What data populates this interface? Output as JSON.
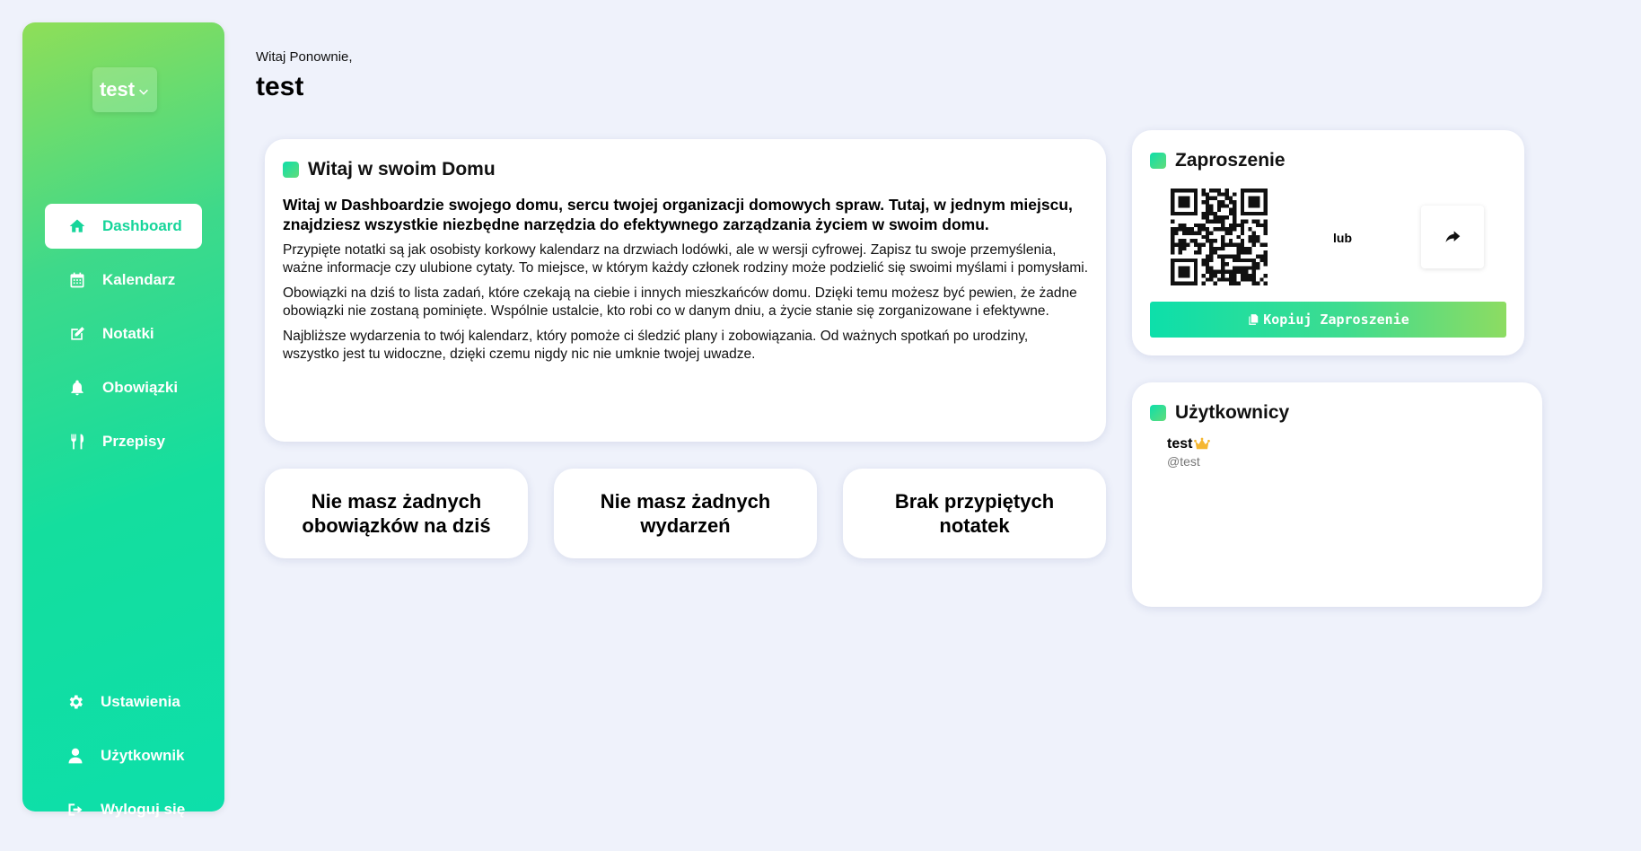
{
  "sidebar": {
    "house_name": "test",
    "nav": [
      {
        "label": "Dashboard",
        "icon": "home-icon",
        "active": true
      },
      {
        "label": "Kalendarz",
        "icon": "calendar-icon"
      },
      {
        "label": "Notatki",
        "icon": "edit-icon"
      },
      {
        "label": "Obowiązki",
        "icon": "bell-icon"
      },
      {
        "label": "Przepisy",
        "icon": "utensils-icon"
      }
    ],
    "bottom_nav": [
      {
        "label": "Ustawienia",
        "icon": "gear-icon"
      },
      {
        "label": "Użytkownik",
        "icon": "user-icon"
      },
      {
        "label": "Wyloguj się",
        "icon": "logout-icon"
      }
    ]
  },
  "header": {
    "greeting": "Witaj Ponownie,",
    "username": "test"
  },
  "welcome_card": {
    "title": "Witaj w swoim Domu",
    "lead": "Witaj w Dashboardzie swojego domu, sercu twojej organizacji domowych spraw. Tutaj, w jednym miejscu, znajdziesz wszystkie niezbędne narzędzia do efektywnego zarządzania życiem w swoim domu.",
    "paragraphs": [
      "Przypięte notatki są jak osobisty korkowy kalendarz na drzwiach lodówki, ale w wersji cyfrowej. Zapisz tu swoje przemyślenia, ważne informacje czy ulubione cytaty. To miejsce, w którym każdy członek rodziny może podzielić się swoimi myślami i pomysłami.",
      "Obowiązki na dziś to lista zadań, które czekają na ciebie i innych mieszkańców domu. Dzięki temu możesz być pewien, że żadne obowiązki nie zostaną pominięte. Wspólnie ustalcie, kto robi co w danym dniu, a życie stanie się zorganizowane i efektywne.",
      "Najbliższe wydarzenia to twój kalendarz, który pomoże ci śledzić plany i zobowiązania. Od ważnych spotkań po urodziny, wszystko jest tu widoczne, dzięki czemu nigdy nic nie umknie twojej uwadze."
    ]
  },
  "info_cards": [
    "Nie masz żadnych obowiązków na dziś",
    "Nie masz żadnych wydarzeń",
    "Brak przypiętych notatek"
  ],
  "invite_card": {
    "title": "Zaproszenie",
    "or_label": "lub",
    "copy_label": "Kopiuj Zaproszenie",
    "share_icon": "share-icon",
    "copy_icon": "copy-icon"
  },
  "users_card": {
    "title": "Użytkownicy",
    "users": [
      {
        "name": "test",
        "handle": "@test",
        "badge_icon": "crown-icon"
      }
    ]
  },
  "colors": {
    "accent": "#16d59a",
    "background": "#eff2fb",
    "crown": "#f5b731"
  }
}
